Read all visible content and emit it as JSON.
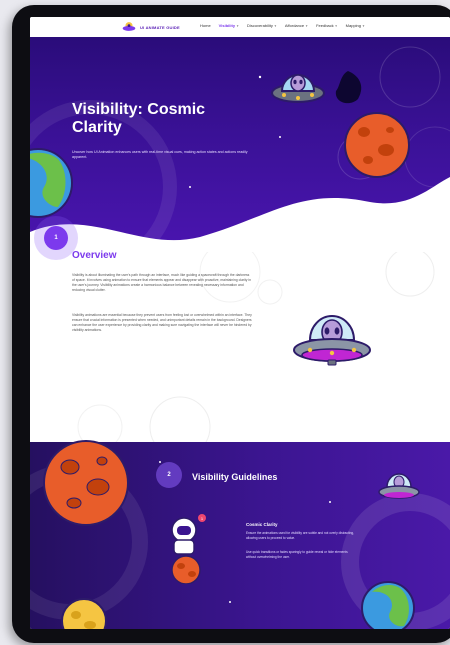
{
  "header": {
    "logo_text": "UI ANIMATE GUIDE",
    "nav": [
      {
        "label": "Home",
        "active": false
      },
      {
        "label": "Visibility",
        "active": true
      },
      {
        "label": "Discoverability",
        "active": false
      },
      {
        "label": "Affordance",
        "active": false
      },
      {
        "label": "Feedback",
        "active": false
      },
      {
        "label": "Mapping",
        "active": false
      }
    ]
  },
  "hero": {
    "title_line1": "Visibility: Cosmic",
    "title_line2": "Clarity",
    "subtitle": "Uncover how UI Animation enhances users with real-time visual cues, making action states and actions readily apparent."
  },
  "overview": {
    "step_number": "1",
    "title": "Overview",
    "paragraph1": "Visibility is about illuminating the user's path through an interface, much like guiding a spacecraft through the darkness of space. It involves using animation to ensure that elements appear and disappear with proactive, maintaining clarity in the user's journey. Visibility animations create a harmonious balance between revealing necessary information and reducing visual clutter.",
    "paragraph2": "Visibility animations are essential because they prevent users from feeling lost or overwhelmed within an interface. They ensure that crucial information is presented when needed, and unimportant details remain in the background. Designers can enhance the user experience by providing clarity and making sure navigating the interface will never be hindered by visibility animations."
  },
  "guidelines": {
    "step_number": "2",
    "title": "Visibility Guidelines",
    "badge": "1",
    "card_title": "Cosmic Clarity",
    "card_text1": "Ensure the animations used for visibility are subtle and not overly distracting, allowing users to proceed to value.",
    "card_text2": "Use quick transitions or fades sparingly to guide reveal or hide elements without overwhelming the user."
  },
  "colors": {
    "accent": "#7c3aed",
    "hero_bg": "#3a1196",
    "planet_orange": "#e85d2a",
    "planet_earth": "#3b9ae0"
  },
  "icons": [
    "ufo-alien-icon",
    "planet-orange-icon",
    "planet-earth-icon",
    "astronaut-icon",
    "chevron-down-icon"
  ]
}
